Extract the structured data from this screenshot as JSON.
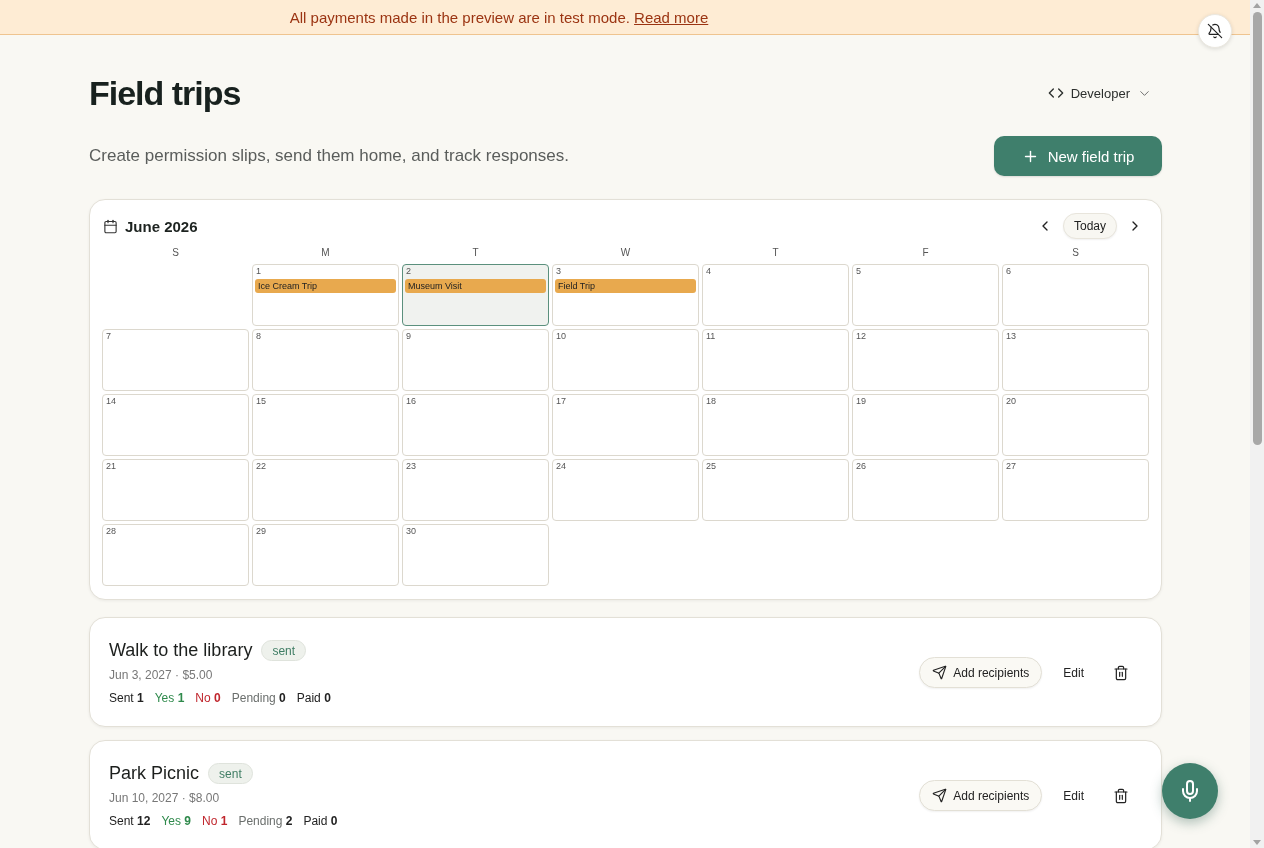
{
  "banner": {
    "message": "All payments made in the preview are in test mode.",
    "link": "Read more"
  },
  "header": {
    "title": "Field trips",
    "role_menu": "Developer",
    "subtitle": "Create permission slips, send them home, and track responses.",
    "new_button": "New field trip"
  },
  "calendar": {
    "month": "June 2026",
    "today_button": "Today",
    "weekdays": [
      "S",
      "M",
      "T",
      "W",
      "T",
      "F",
      "S"
    ],
    "weeks": [
      [
        {
          "kind": "blank"
        },
        {
          "kind": "day",
          "date": "1",
          "selected": false,
          "events": [
            "Ice Cream Trip"
          ]
        },
        {
          "kind": "day",
          "date": "2",
          "selected": true,
          "events": [
            "Museum Visit"
          ]
        },
        {
          "kind": "day",
          "date": "3",
          "selected": false,
          "events": [
            "Field Trip"
          ]
        },
        {
          "kind": "day",
          "date": "4",
          "selected": false
        },
        {
          "kind": "day",
          "date": "5",
          "selected": false
        },
        {
          "kind": "day",
          "date": "6",
          "selected": false
        }
      ],
      [
        {
          "kind": "day",
          "date": "7",
          "selected": false
        },
        {
          "kind": "day",
          "date": "8",
          "selected": false
        },
        {
          "kind": "day",
          "date": "9",
          "selected": false
        },
        {
          "kind": "day",
          "date": "10",
          "selected": false
        },
        {
          "kind": "day",
          "date": "11",
          "selected": false
        },
        {
          "kind": "day",
          "date": "12",
          "selected": false
        },
        {
          "kind": "day",
          "date": "13",
          "selected": false
        }
      ],
      [
        {
          "kind": "day",
          "date": "14",
          "selected": false
        },
        {
          "kind": "day",
          "date": "15",
          "selected": false
        },
        {
          "kind": "day",
          "date": "16",
          "selected": false
        },
        {
          "kind": "day",
          "date": "17",
          "selected": false
        },
        {
          "kind": "day",
          "date": "18",
          "selected": false
        },
        {
          "kind": "day",
          "date": "19",
          "selected": false
        },
        {
          "kind": "day",
          "date": "20",
          "selected": false
        }
      ],
      [
        {
          "kind": "day",
          "date": "21",
          "selected": false
        },
        {
          "kind": "day",
          "date": "22",
          "selected": false
        },
        {
          "kind": "day",
          "date": "23",
          "selected": false
        },
        {
          "kind": "day",
          "date": "24",
          "selected": false
        },
        {
          "kind": "day",
          "date": "25",
          "selected": false
        },
        {
          "kind": "day",
          "date": "26",
          "selected": false
        },
        {
          "kind": "day",
          "date": "27",
          "selected": false
        }
      ],
      [
        {
          "kind": "day",
          "date": "28",
          "selected": false
        },
        {
          "kind": "day",
          "date": "29",
          "selected": false
        },
        {
          "kind": "day",
          "date": "30",
          "selected": false
        }
      ]
    ]
  },
  "trips": [
    {
      "title": "Walk to the library",
      "status": "sent",
      "meta": "Jun 3, 2027 · $5.00",
      "stats": [
        {
          "kind": "sent",
          "text": "Sent **1**"
        },
        {
          "kind": "yes",
          "text": "Yes **1**"
        },
        {
          "kind": "no",
          "text": "No **0**"
        },
        {
          "kind": "pending",
          "text": "Pending **0**"
        },
        {
          "kind": "paid",
          "text": "Paid **0**"
        }
      ],
      "add_button": "Add recipients",
      "edit_button": "Edit"
    },
    {
      "title": "Park Picnic",
      "status": "sent",
      "meta": "Jun 10, 2027 · $8.00",
      "stats": [
        {
          "kind": "sent",
          "text": "Sent **12**"
        },
        {
          "kind": "yes",
          "text": "Yes **9**"
        },
        {
          "kind": "no",
          "text": "No **1**"
        },
        {
          "kind": "pending",
          "text": "Pending **2**"
        },
        {
          "kind": "paid",
          "text": "Paid **0**"
        }
      ],
      "add_button": "Add recipients",
      "edit_button": "Edit"
    }
  ]
}
